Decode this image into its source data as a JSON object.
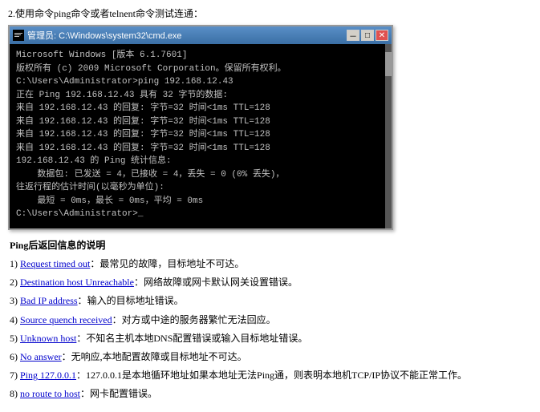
{
  "intro": {
    "text": "2.使用命令ping命令或者telnent命令测试连通："
  },
  "cmd_window": {
    "title": "管理员: C:\\Windows\\system32\\cmd.exe",
    "lines": [
      {
        "text": "Microsoft Windows [版本 6.1.7601]",
        "style": "normal"
      },
      {
        "text": "版权所有 (c) 2009 Microsoft Corporation。保留所有权利。",
        "style": "normal"
      },
      {
        "text": "",
        "style": "normal"
      },
      {
        "text": "C:\\Users\\Administrator>ping 192.168.12.43",
        "style": "normal"
      },
      {
        "text": "",
        "style": "normal"
      },
      {
        "text": "正在 Ping 192.168.12.43 具有 32 字节的数据:",
        "style": "normal"
      },
      {
        "text": "来自 192.168.12.43 的回复: 字节=32 时间<1ms TTL=128",
        "style": "normal"
      },
      {
        "text": "来自 192.168.12.43 的回复: 字节=32 时间<1ms TTL=128",
        "style": "normal"
      },
      {
        "text": "来自 192.168.12.43 的回复: 字节=32 时间<1ms TTL=128",
        "style": "normal"
      },
      {
        "text": "来自 192.168.12.43 的回复: 字节=32 时间<1ms TTL=128",
        "style": "normal"
      },
      {
        "text": "",
        "style": "normal"
      },
      {
        "text": "192.168.12.43 的 Ping 统计信息:",
        "style": "normal"
      },
      {
        "text": "    数据包: 已发送 = 4，已接收 = 4，丢失 = 0 (0% 丢失)，",
        "style": "normal"
      },
      {
        "text": "往返行程的估计时间(以毫秒为单位):",
        "style": "normal"
      },
      {
        "text": "    最短 = 0ms，最长 = 0ms，平均 = 0ms",
        "style": "normal"
      },
      {
        "text": "",
        "style": "normal"
      },
      {
        "text": "C:\\Users\\Administrator>_",
        "style": "normal"
      }
    ]
  },
  "ping_info": {
    "title": "Ping后返回信息的说明",
    "items": [
      {
        "number": "1)",
        "label": "Request timed out",
        "colon": "：",
        "text": "最常见的故障，目标地址不可达。"
      },
      {
        "number": "2)",
        "label": "Destination host Unreachable",
        "colon": "：",
        "text": "网络故障或网卡默认网关设置错误。"
      },
      {
        "number": "3)",
        "label": "Bad IP address",
        "colon": "：",
        "text": "输入的目标地址错误。"
      },
      {
        "number": "4)",
        "label": "Source quench received",
        "colon": "：",
        "text": "对方或中途的服务器繁忙无法回应。"
      },
      {
        "number": "5)",
        "label": "Unknown host",
        "colon": "：",
        "text": "不知名主机本地DNS配置错误或输入目标地址错误。"
      },
      {
        "number": "6)",
        "label": "No answer",
        "colon": "：无响应,本地配置故障或目标地址不可达。"
      },
      {
        "number": "7)",
        "label": "Ping 127.0.0.1",
        "colon": "：",
        "text": "127.0.0.1是本地循环地址如果本地址无法Ping通，则表明本地机TCP/IP协议不能正常工作。"
      },
      {
        "number": "8)",
        "label": "no route to host",
        "colon": "：",
        "text": "网卡配置错误。"
      }
    ]
  }
}
